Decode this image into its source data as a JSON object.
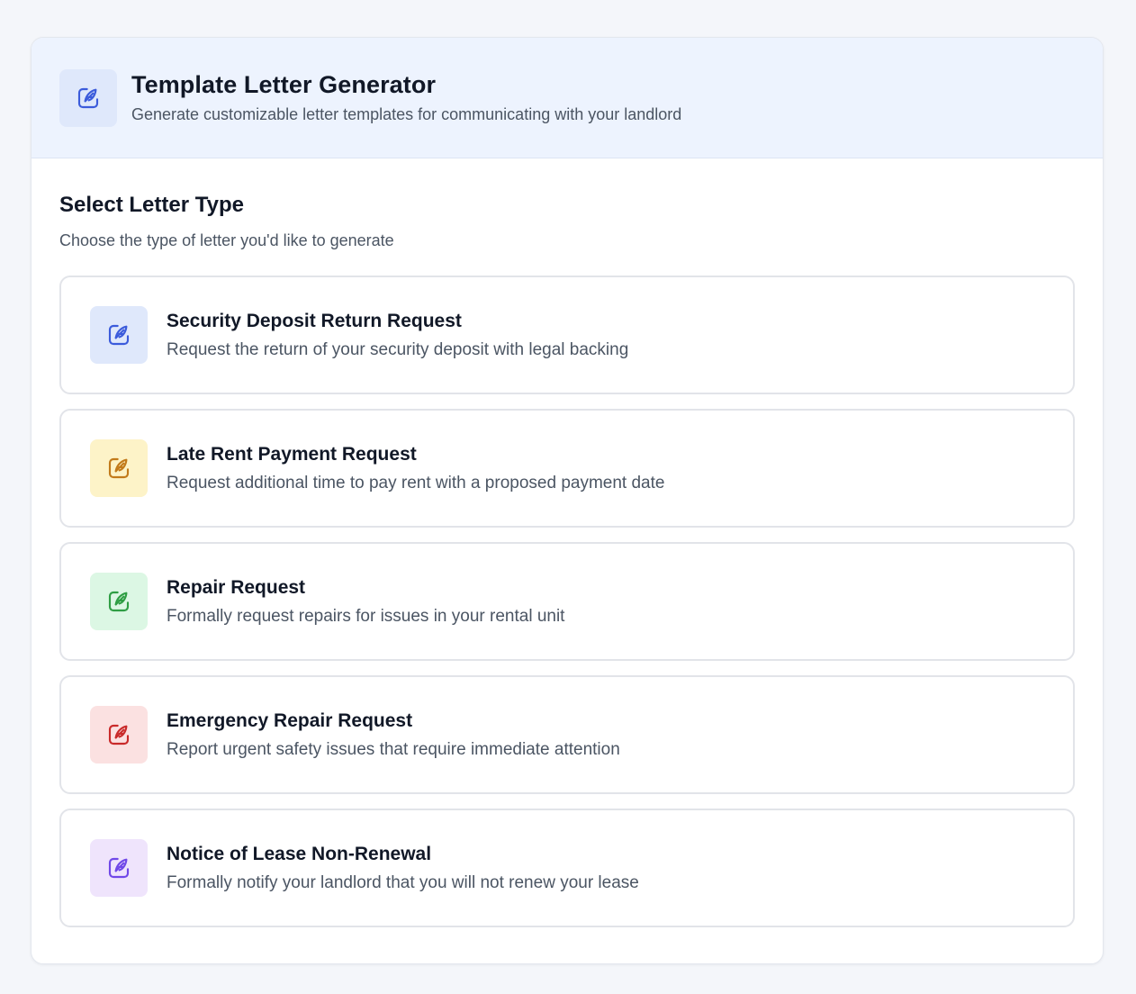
{
  "header": {
    "icon": "feather-pen-icon",
    "title": "Template Letter Generator",
    "subtitle": "Generate customizable letter templates for communicating with your landlord",
    "icon_bg": "#dfe8fb",
    "icon_color": "#3b5bdb"
  },
  "section": {
    "title": "Select Letter Type",
    "subtitle": "Choose the type of letter you'd like to generate"
  },
  "letter_types": [
    {
      "title": "Security Deposit Return Request",
      "description": "Request the return of your security deposit with legal backing",
      "icon": "feather-pen-icon",
      "icon_bg": "#dfe8fb",
      "icon_color": "#3b5bdb"
    },
    {
      "title": "Late Rent Payment Request",
      "description": "Request additional time to pay rent with a proposed payment date",
      "icon": "feather-pen-icon",
      "icon_bg": "#fdf3c8",
      "icon_color": "#c27a1a"
    },
    {
      "title": "Repair Request",
      "description": "Formally request repairs for issues in your rental unit",
      "icon": "feather-pen-icon",
      "icon_bg": "#dcf7e4",
      "icon_color": "#2f9e44"
    },
    {
      "title": "Emergency Repair Request",
      "description": "Report urgent safety issues that require immediate attention",
      "icon": "feather-pen-icon",
      "icon_bg": "#fbe1e1",
      "icon_color": "#c92a2a"
    },
    {
      "title": "Notice of Lease Non-Renewal",
      "description": "Formally notify your landlord that you will not renew your lease",
      "icon": "feather-pen-icon",
      "icon_bg": "#efe4fc",
      "icon_color": "#7048e8"
    }
  ]
}
